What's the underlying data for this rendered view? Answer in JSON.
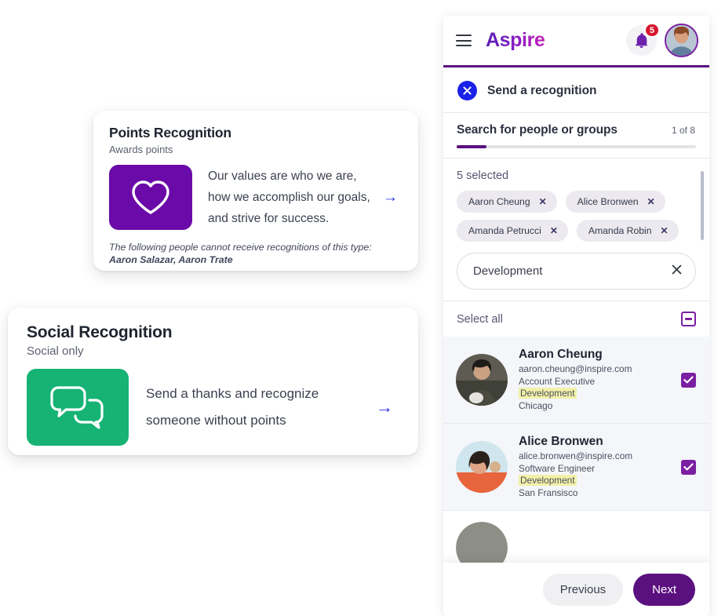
{
  "cards": [
    {
      "title": "Points Recognition",
      "subtitle": "Awards points",
      "description": "Our values are who we are, how we accomplish our goals, and strive for success.",
      "icon": "heart-icon",
      "tile_color": "#6a0aa8",
      "arrow": "→",
      "note_prefix": "The following people cannot receive recognitions of this type: ",
      "note_names": "Aaron Salazar, Aaron Trate"
    },
    {
      "title": "Social Recognition",
      "subtitle": "Social only",
      "description": "Send a thanks and recognize someone without points",
      "icon": "chat-bubbles-icon",
      "tile_color": "#16b374",
      "arrow": "→"
    }
  ],
  "header": {
    "menu_icon": "hamburger-menu-icon",
    "brand": "Aspire",
    "bell_icon": "notification-bell-icon",
    "notification_count": "5",
    "avatar": "user-avatar"
  },
  "dialog": {
    "close_icon": "close-icon",
    "title": "Send a recognition",
    "step_label": "Search for people or groups",
    "step_count": "1 of 8",
    "progress_percent": 12.5
  },
  "selection": {
    "selected_count_label": "5 selected",
    "chips": [
      {
        "name": "Aaron Cheung",
        "remove": "✕"
      },
      {
        "name": "Alice Bronwen",
        "remove": "✕"
      },
      {
        "name": "Amanda Petrucci",
        "remove": "✕"
      },
      {
        "name": "Amanda Robin",
        "remove": "✕"
      }
    ]
  },
  "search": {
    "value": "Development",
    "placeholder": "Search for people or groups",
    "clear_icon": "clear-icon"
  },
  "select_all": {
    "label": "Select all",
    "state": "indeterminate"
  },
  "people": [
    {
      "name": "Aaron Cheung",
      "email": "aaron.cheung@inspire.com",
      "role": "Account Executive",
      "department": "Development",
      "location": "Chicago",
      "checked": true
    },
    {
      "name": "Alice Bronwen",
      "email": "alice.bronwen@inspire.com",
      "role": "Software Engineer",
      "department": "Development",
      "location": "San Fransisco",
      "checked": true
    }
  ],
  "footer": {
    "previous_label": "Previous",
    "next_label": "Next"
  },
  "colors": {
    "brand_purple": "#5b1080",
    "accent_purple": "#7b1fa2",
    "green": "#16b374",
    "blue": "#1a21e8",
    "badge_red": "#d6172c",
    "highlight_yellow": "#f2f0a8"
  }
}
